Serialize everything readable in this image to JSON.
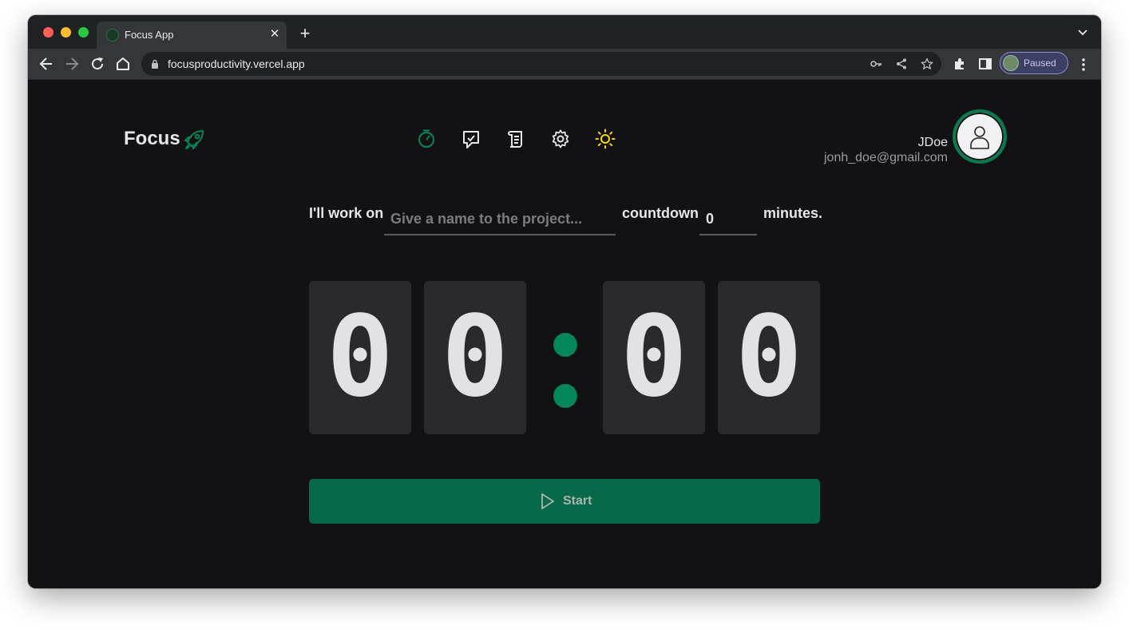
{
  "browser": {
    "tab_title": "Focus App",
    "url": "focusproductivity.vercel.app",
    "profile_label": "Paused"
  },
  "app": {
    "brand": "Focus",
    "accent_color": "#03865a",
    "nav_icons": [
      "timer-icon",
      "tasks-icon",
      "history-icon",
      "settings-icon",
      "theme-sun-icon"
    ],
    "user": {
      "name": "JDoe",
      "email": "jonh_doe@gmail.com"
    }
  },
  "work": {
    "prefix": "I'll work on",
    "project_placeholder": "Give a name to the project...",
    "countdown_label": "countdown",
    "minutes_value": "0",
    "minutes_suffix": "minutes."
  },
  "timer": {
    "minutes_tens": "0",
    "minutes_ones": "0",
    "seconds_tens": "0",
    "seconds_ones": "0"
  },
  "actions": {
    "start_label": "Start"
  }
}
